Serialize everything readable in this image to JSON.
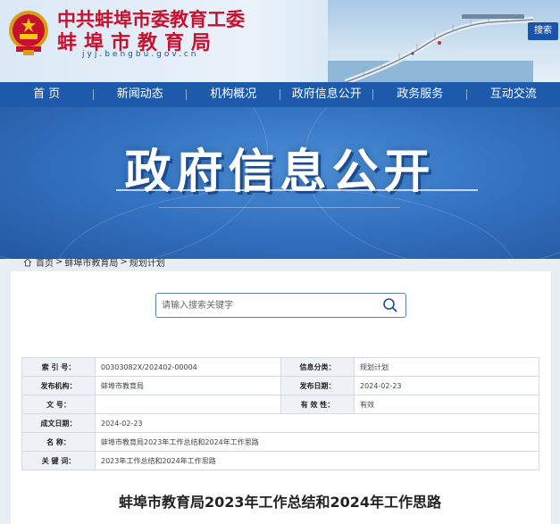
{
  "header": {
    "title_line1": "中共蚌埠市委教育工委",
    "title_line2": "蚌埠市教育局",
    "url": "jyj.bengbu.gov.cn",
    "search_button": "搜索"
  },
  "nav": {
    "items": [
      "首 页",
      "新闻动态",
      "机构概况",
      "政府信息公开",
      "政务服务",
      "互动交流"
    ]
  },
  "banner": {
    "title": "政府信息公开"
  },
  "breadcrumb": {
    "items": [
      "首页",
      ">",
      "蚌埠市教育局",
      ">",
      "规划计划"
    ]
  },
  "search": {
    "placeholder": "请输入搜索关键字"
  },
  "info": {
    "index_label": "索 引 号：",
    "index_value": "00303082X/202402-00004",
    "category_label": "信息分类：",
    "category_value": "规划计划",
    "publisher_label": "发布机构：",
    "publisher_value": "蚌埠市教育局",
    "pubdate_label": "发布日期：",
    "pubdate_value": "2024-02-23",
    "docno_label": "文 号：",
    "docno_value": "",
    "validity_label": "有 效 性：",
    "validity_value": "有效",
    "created_label": "成文日期：",
    "created_value": "2024-02-23",
    "name_label": "名 称：",
    "name_value": "蚌埠市教育局2023年工作总结和2024年工作思路",
    "keywords_label": "关 键 词：",
    "keywords_value": "2023年工作总结和2024年工作思路"
  },
  "document": {
    "title": "蚌埠市教育局2023年工作总结和2024年工作思路"
  },
  "colors": {
    "title_red": "#c8102e",
    "nav_blue": "#1e5aab",
    "banner_blue": "#3474c3"
  }
}
